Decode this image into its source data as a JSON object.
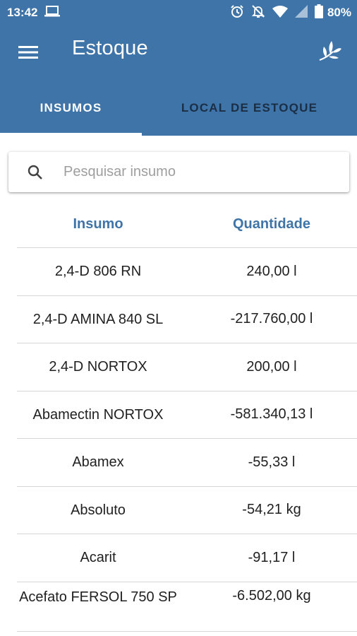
{
  "status_bar": {
    "time": "13:42",
    "battery": "80%"
  },
  "app_bar": {
    "title": "Estoque",
    "color": "#3f74a8"
  },
  "tabs": [
    {
      "label": "INSUMOS",
      "active": true
    },
    {
      "label": "LOCAL DE ESTOQUE",
      "active": false
    }
  ],
  "search": {
    "placeholder": "Pesquisar insumo",
    "value": ""
  },
  "table": {
    "headers": {
      "name": "Insumo",
      "quantity": "Quantidade"
    },
    "rows": [
      {
        "name": "2,4-D 806 RN",
        "quantity": "240,00 l"
      },
      {
        "name": "2,4-D AMINA 840 SL",
        "quantity": "-217.760,00 l"
      },
      {
        "name": "2,4-D NORTOX",
        "quantity": "200,00 l"
      },
      {
        "name": "Abamectin NORTOX",
        "quantity": "-581.340,13 l"
      },
      {
        "name": "Abamex",
        "quantity": "-55,33 l"
      },
      {
        "name": "Absoluto",
        "quantity": "-54,21 kg"
      },
      {
        "name": "Acarit",
        "quantity": "-91,17 l"
      },
      {
        "name": "Acefato FERSOL 750 SP",
        "quantity": "-6.502,00 kg"
      }
    ]
  },
  "icons": {
    "menu": "hamburger-menu-icon",
    "logo": "leaf-plant-icon",
    "search": "search-icon",
    "status": [
      "laptop-icon",
      "alarm-icon",
      "notifications-off-icon",
      "wifi-icon",
      "signal-icon",
      "battery-icon"
    ]
  }
}
